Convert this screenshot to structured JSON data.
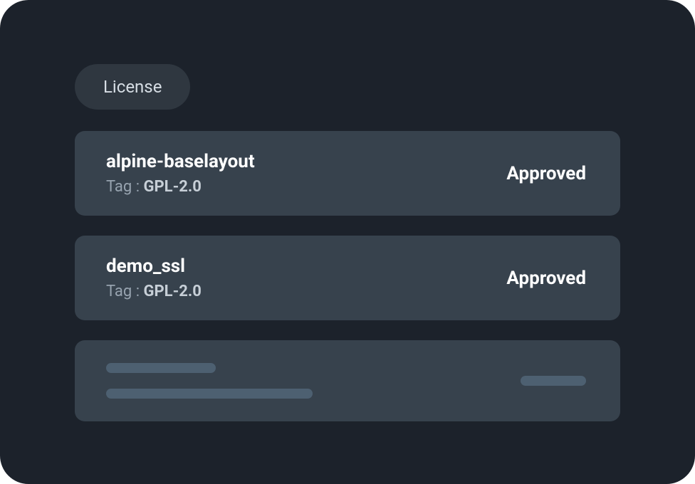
{
  "tab": {
    "label": "License"
  },
  "cards": [
    {
      "name": "alpine-baselayout",
      "tag_label": "Tag : ",
      "tag_value": "GPL-2.0",
      "status": "Approved"
    },
    {
      "name": "demo_ssl",
      "tag_label": "Tag : ",
      "tag_value": "GPL-2.0",
      "status": "Approved"
    }
  ]
}
